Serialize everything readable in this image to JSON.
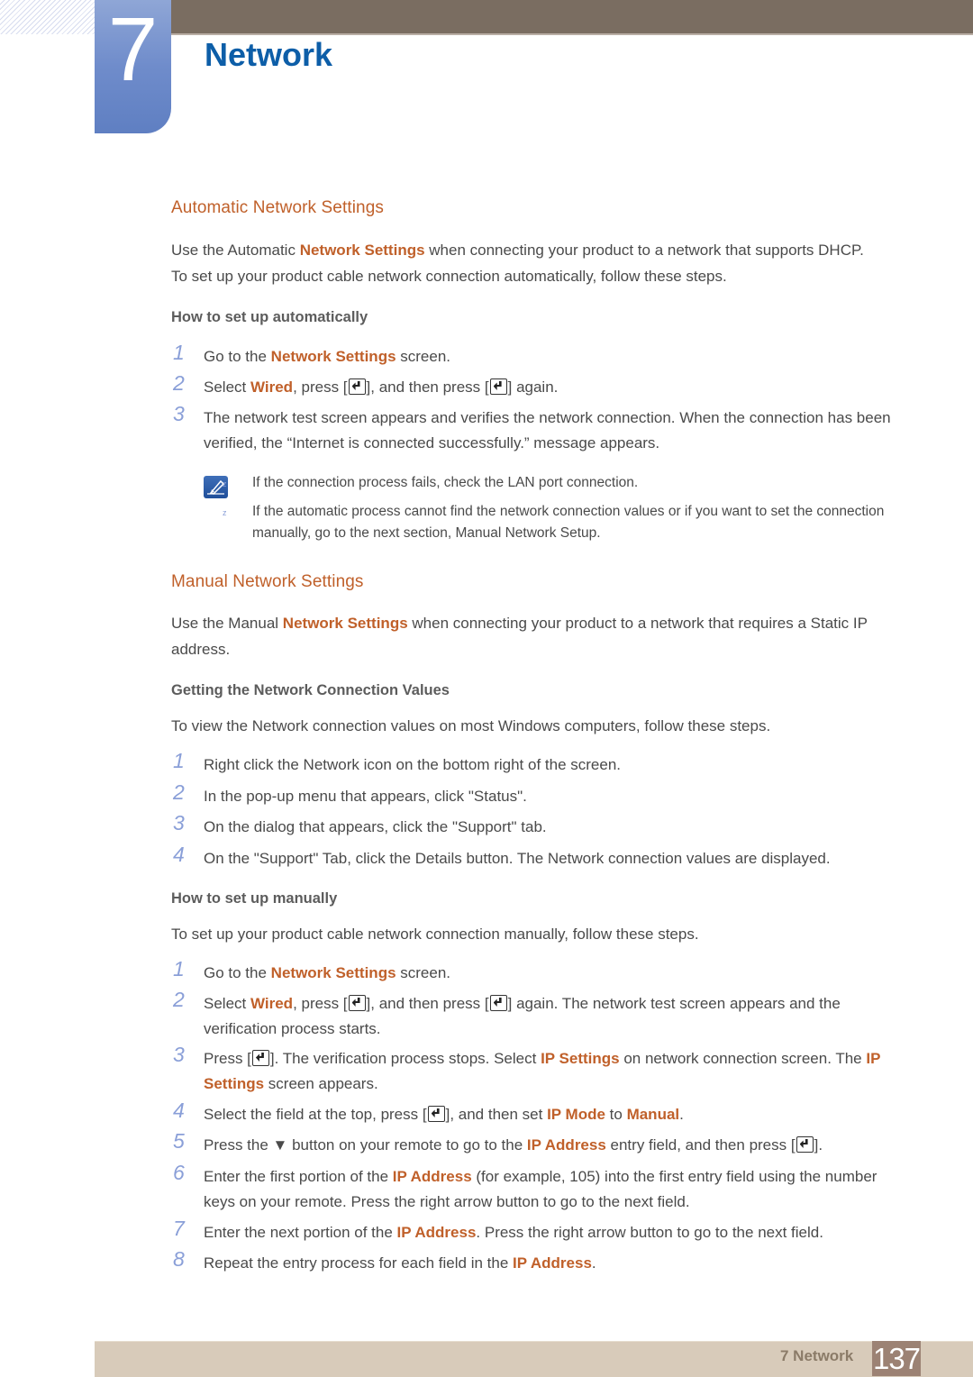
{
  "chapter": {
    "number": "7",
    "title": "Network"
  },
  "sections": {
    "automatic": {
      "heading": "Automatic Network Settings",
      "intro_line1_pre": "Use the Automatic ",
      "intro_line1_hl": "Network Settings",
      "intro_line1_post": " when connecting your product to a network that supports DHCP.",
      "intro_line2": "To set up your product cable network connection automatically, follow these steps.",
      "subheading": "How to set up automatically",
      "steps": [
        {
          "num": "1",
          "pre": "Go to the ",
          "hl": "Network Settings",
          "post": " screen."
        },
        {
          "num": "2",
          "pre": "Select ",
          "hl": "Wired",
          "mid1": ", press [",
          "mid2": "], and then press [",
          "post": "] again."
        },
        {
          "num": "3",
          "text": "The network test screen appears and verifies the network connection. When the connection has been verified, the “Internet is connected successfully.” message appears."
        }
      ],
      "notes": [
        "If the connection process fails, check the LAN port connection.",
        "If the automatic process cannot find the network connection values or if you want to set the connection manually, go to the next section, Manual Network Setup."
      ],
      "note_bullet": "z"
    },
    "manual": {
      "heading": "Manual Network Settings",
      "intro_pre": "Use the Manual ",
      "intro_hl": "Network Settings",
      "intro_post": " when connecting your product to a network that requires a Static IP address.",
      "values_subheading": "Getting the Network Connection Values",
      "values_intro": "To view the Network connection values on most Windows computers, follow these steps.",
      "values_steps": [
        {
          "num": "1",
          "text": "Right click the Network icon on the bottom right of the screen."
        },
        {
          "num": "2",
          "text": "In the pop-up menu that appears, click \"Status\"."
        },
        {
          "num": "3",
          "text": "On the dialog that appears, click the \"Support\" tab."
        },
        {
          "num": "4",
          "text": "On the \"Support\" Tab, click the Details button. The Network connection values are displayed."
        }
      ],
      "setup_subheading": "How to set up manually",
      "setup_intro": "To set up your product cable network connection manually, follow these steps.",
      "setup_steps": [
        {
          "num": "1",
          "a": "Go to the ",
          "b": "Network Settings",
          "c": " screen."
        },
        {
          "num": "2",
          "a": "Select ",
          "b": "Wired",
          "c": ", press [",
          "d": "], and then press [",
          "e": "] again. The network test screen appears and the verification process starts."
        },
        {
          "num": "3",
          "a": "Press [",
          "b": "]. The verification process stops. Select ",
          "c": "IP Settings",
          "d": " on network connection screen. The ",
          "e": "IP Settings",
          "f": " screen appears."
        },
        {
          "num": "4",
          "a": "Select the field at the top, press [",
          "b": "], and then set ",
          "c": "IP Mode",
          "d": " to ",
          "e": "Manual",
          "f": "."
        },
        {
          "num": "5",
          "a": "Press the ▼ button on your remote to go to the ",
          "b": "IP Address",
          "c": " entry field, and then press [",
          "d": "]."
        },
        {
          "num": "6",
          "a": "Enter the first portion of the ",
          "b": "IP Address",
          "c": " (for example, 105) into the first entry field using the number keys on your remote. Press the right arrow button to go to the next field."
        },
        {
          "num": "7",
          "a": "Enter the next portion of the ",
          "b": "IP Address",
          "c": ". Press the right arrow button to go to the next field."
        },
        {
          "num": "8",
          "a": "Repeat the entry process for each field in the ",
          "b": "IP Address",
          "c": "."
        }
      ]
    }
  },
  "footer": {
    "label": "7 Network",
    "page": "137"
  },
  "colors": {
    "accent": "#c0602a",
    "title_blue": "#0d5ea8",
    "step_num": "#8a9fd8",
    "header_bar": "#7a6d61",
    "footer_bar": "#d8cbba",
    "page_box": "#9c8274"
  }
}
